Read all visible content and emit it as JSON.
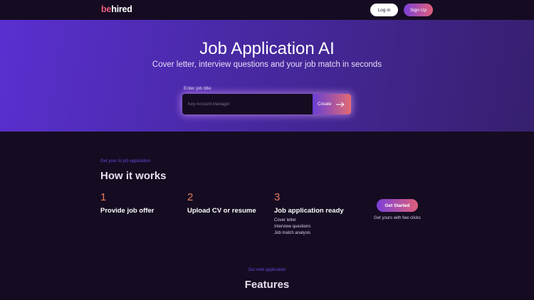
{
  "header": {
    "logo_prefix": "be",
    "logo_suffix": "hired",
    "login_label": "Log in",
    "signup_label": "Sign Up"
  },
  "hero": {
    "title": "Job Application AI",
    "subtitle": "Cover letter, interview questions and your job match in seconds",
    "field_label": "Enter job title:",
    "input_placeholder": "Key Account Manager",
    "input_value": "",
    "create_label": "Create"
  },
  "how_it_works": {
    "eyebrow": "Get your AI job application",
    "title": "How it works",
    "steps": [
      {
        "number": "1",
        "title": "Provide job offer"
      },
      {
        "number": "2",
        "title": "Upload CV or resume"
      },
      {
        "number": "3",
        "title": "Job application ready",
        "items": [
          "Cover letter",
          "Interview questions",
          "Job match analysis"
        ]
      }
    ],
    "cta_label": "Get Started",
    "cta_note": "Get yours with few clicks"
  },
  "features": {
    "eyebrow": "Our web application",
    "title": "Features"
  },
  "colors": {
    "background": "#150c22",
    "hero_start": "#5a2fd0",
    "hero_end": "#36206e",
    "accent_purple": "#7b3fd8",
    "accent_pink": "#e0607a",
    "step_number": "#e87a62"
  }
}
